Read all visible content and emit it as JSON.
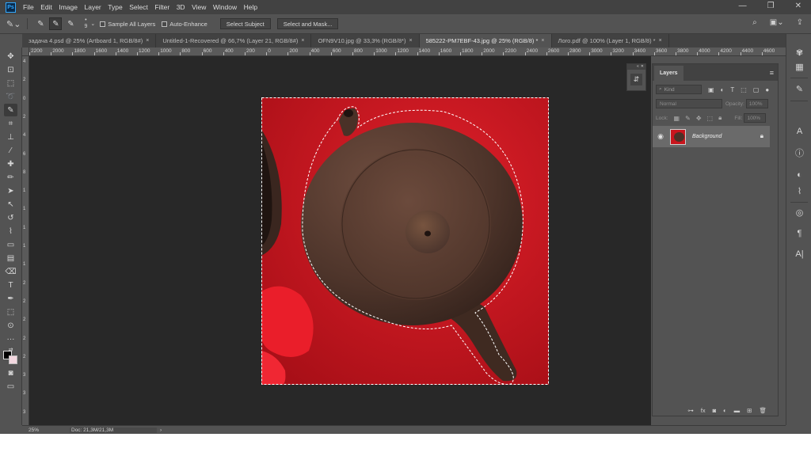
{
  "app": {
    "logo": "Ps"
  },
  "menu": [
    "File",
    "Edit",
    "Image",
    "Layer",
    "Type",
    "Select",
    "Filter",
    "3D",
    "View",
    "Window",
    "Help"
  ],
  "window_controls": {
    "minimize": "—",
    "restore": "❐",
    "close": "✕"
  },
  "options": {
    "brush_size": "9",
    "sample_all_layers": "Sample All Layers",
    "auto_enhance": "Auto-Enhance",
    "select_subject": "Select Subject",
    "select_and_mask": "Select and Mask..."
  },
  "tabs": [
    {
      "label": "задача 4.psd @ 25% (Artboard 1, RGB/8#)",
      "close": "×",
      "active": false
    },
    {
      "label": "Untitled-1-Recovered @ 66,7% (Layer 21, RGB/8#)",
      "close": "×",
      "active": false
    },
    {
      "label": "OFN9V10.jpg @ 33,3% (RGB/8*)",
      "close": "×",
      "active": false
    },
    {
      "label": "585222-PM7EBF-43.jpg @ 25% (RGB/8) *",
      "close": "×",
      "active": true
    },
    {
      "label": "Лого.pdf @ 100% (Layer 1, RGB/8) *",
      "close": "×",
      "active": false
    }
  ],
  "ruler_h": [
    "2200",
    "2000",
    "1800",
    "1600",
    "1400",
    "1200",
    "1000",
    "800",
    "600",
    "400",
    "200",
    "0",
    "200",
    "400",
    "600",
    "800",
    "1000",
    "1200",
    "1400",
    "1600",
    "1800",
    "2000",
    "2200",
    "2400",
    "2600",
    "2800",
    "3000",
    "3200",
    "3400",
    "3600",
    "3800",
    "4000",
    "4200",
    "4400",
    "4600"
  ],
  "ruler_v": [
    "4",
    "2",
    "0",
    "2",
    "4",
    "6",
    "8",
    "1",
    "1",
    "1",
    "1",
    "1",
    "2",
    "2",
    "2",
    "2",
    "2",
    "3",
    "3",
    "3"
  ],
  "status": {
    "zoom": "25%",
    "doc": "Doc: 21,3M/21,3M",
    "arrow": "›"
  },
  "layers_panel": {
    "tab": "Layers",
    "filter_placeholder": "Kind",
    "blend_mode": "Normal",
    "opacity_label": "Opacity:",
    "opacity_value": "100%",
    "lock_label": "Lock:",
    "fill_label": "Fill:",
    "fill_value": "100%",
    "layer_name": "Background"
  },
  "colors": {
    "canvas_red": "#c8151d",
    "teapot": "#4a3227",
    "ui_bg": "#535353",
    "workspace": "#282828"
  }
}
